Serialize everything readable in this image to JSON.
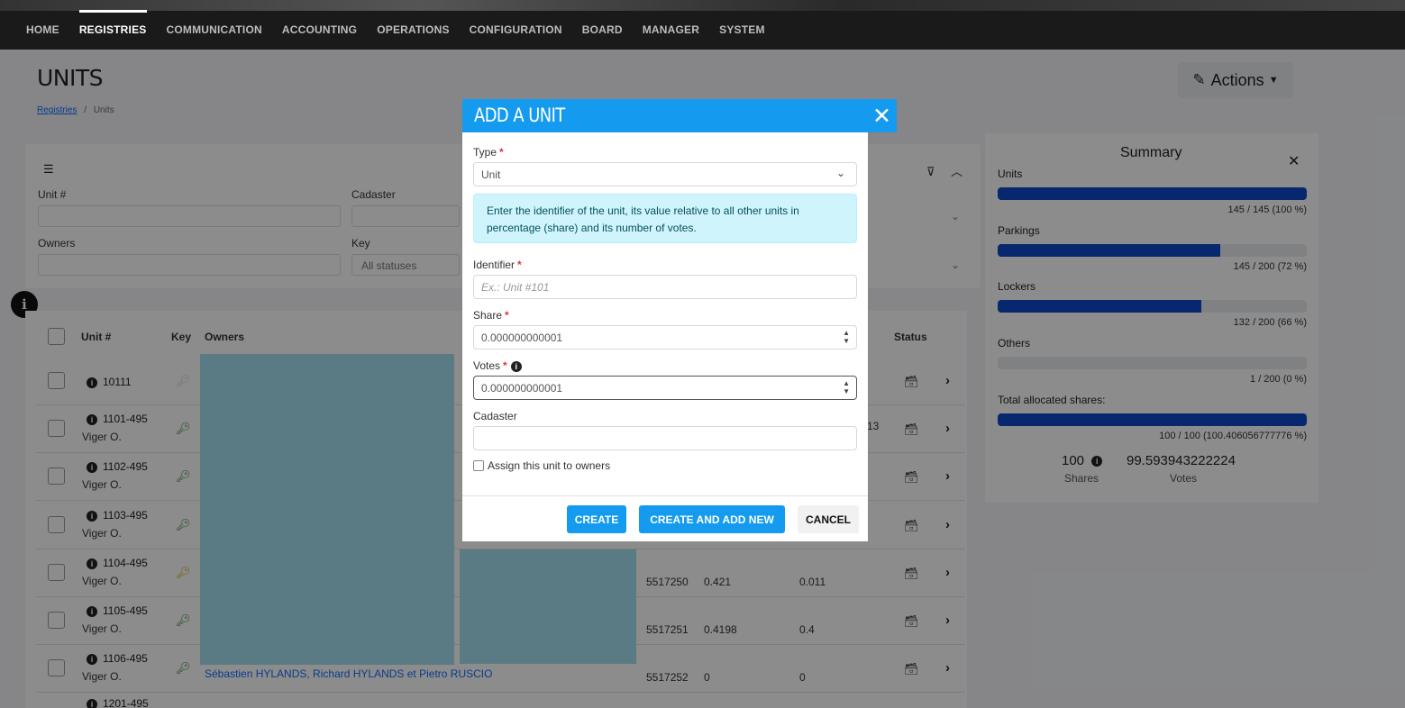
{
  "nav": [
    "HOME",
    "REGISTRIES",
    "COMMUNICATION",
    "ACCOUNTING",
    "OPERATIONS",
    "CONFIGURATION",
    "BOARD",
    "MANAGER",
    "SYSTEM"
  ],
  "page": {
    "title": "UNITS",
    "breadcrumb_link": "Registries",
    "breadcrumb_sep": "/",
    "breadcrumb_current": "Units",
    "actions_label": "Actions"
  },
  "filters": {
    "unit_label": "Unit #",
    "cadaster_label": "Cadaster",
    "owners_label": "Owners",
    "key_label": "Key",
    "key_value": "All statuses"
  },
  "table": {
    "headers": {
      "unit": "Unit #",
      "key": "Key",
      "owners": "Owners",
      "status": "Status"
    },
    "rows": [
      {
        "unit": "10111",
        "sub": "",
        "key_color": "#cfcfcf",
        "c1": "",
        "c2": "",
        "c3": ""
      },
      {
        "unit": "1101-495",
        "sub": "Viger O.",
        "key_color": "#2e8b2e",
        "c1": "",
        "c2": "",
        "c3": ""
      },
      {
        "unit": "1102-495",
        "sub": "Viger O.",
        "key_color": "#2e8b2e",
        "c1": "",
        "c2": "",
        "c3": ""
      },
      {
        "unit": "1103-495",
        "sub": "Viger O.",
        "key_color": "#2e8b2e",
        "c1": "",
        "c2": "",
        "c3": ""
      },
      {
        "unit": "1104-495",
        "sub": "Viger O.",
        "key_color": "#d9a400",
        "c1": "5517250",
        "c2": "0.421",
        "c3": "0.011"
      },
      {
        "unit": "1105-495",
        "sub": "Viger O.",
        "key_color": "#2e8b2e",
        "c1": "5517251",
        "c2": "0.4198",
        "c3": "0.4"
      },
      {
        "unit": "1106-495",
        "sub": "Viger O.",
        "key_color": "#2e8b2e",
        "c1": "5517252",
        "c2": "0",
        "c3": "0"
      }
    ],
    "partial_row": "1201-495",
    "partial_cell": "13",
    "owner_link": "Sébastien HYLANDS, Richard HYLANDS et Pietro RUSCIO"
  },
  "summary": {
    "title": "Summary",
    "items": [
      {
        "label": "Units",
        "value": "145 / 145 (100 %)",
        "fraction": 1.0
      },
      {
        "label": "Parkings",
        "value": "145 / 200 (72 %)",
        "fraction": 0.72
      },
      {
        "label": "Lockers",
        "value": "132 / 200 (66 %)",
        "fraction": 0.66
      },
      {
        "label": "Others",
        "value": "1 / 200 (0 %)",
        "fraction": 0.0
      },
      {
        "label": "Total allocated shares:",
        "value": "100 / 100 (100.406056777776 %)",
        "fraction": 1.0
      }
    ],
    "shares_num": "100",
    "shares_label": "Shares",
    "votes_num": "99.593943222224",
    "votes_label": "Votes"
  },
  "modal": {
    "title": "ADD A UNIT",
    "type_label": "Type",
    "type_value": "Unit",
    "info": "Enter the identifier of the unit, its value relative to all other units in percentage (share) and its number of votes.",
    "identifier_label": "Identifier",
    "identifier_placeholder": "Ex.: Unit #101",
    "share_label": "Share",
    "share_value": "0.000000000001",
    "votes_label": "Votes",
    "votes_value": "0.000000000001",
    "cadaster_label": "Cadaster",
    "assign_label": "Assign this unit to owners",
    "create": "CREATE",
    "create_new": "CREATE AND ADD NEW",
    "cancel": "CANCEL"
  },
  "colors": {
    "accent": "#149bf0",
    "progress": "#0d47c8",
    "nav_bg": "#1a1a1a"
  }
}
